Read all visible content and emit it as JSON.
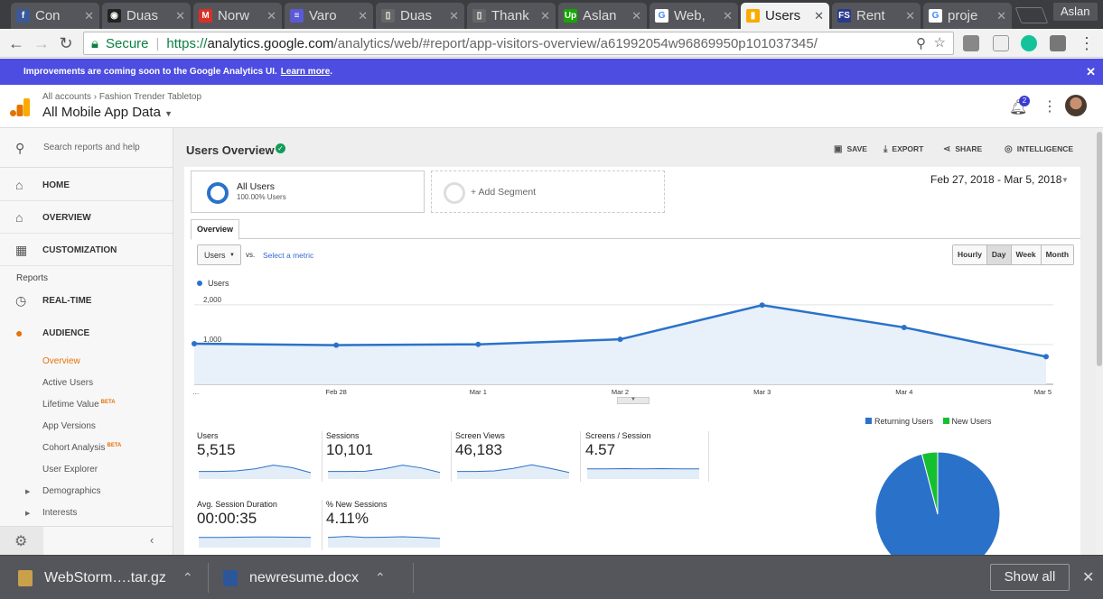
{
  "browser": {
    "tabs": [
      {
        "label": "Con",
        "favicon_color": "#3b5998",
        "favicon_text": "f"
      },
      {
        "label": "Duas",
        "favicon_color": "#222222",
        "favicon_text": "◉"
      },
      {
        "label": "Norw",
        "favicon_color": "#d93025",
        "favicon_text": "M"
      },
      {
        "label": "Varo",
        "favicon_color": "#5a5ad6",
        "favicon_text": "≡"
      },
      {
        "label": "Duas",
        "favicon_color": "#666666",
        "favicon_text": "▯"
      },
      {
        "label": "Thank",
        "favicon_color": "#666666",
        "favicon_text": "▯"
      },
      {
        "label": "Aslan",
        "favicon_color": "#14a800",
        "favicon_text": "Up"
      },
      {
        "label": "Web,",
        "favicon_color": "#ffffff",
        "favicon_text": "G"
      },
      {
        "label": "Users",
        "favicon_color": "#f9ab00",
        "favicon_text": "▮"
      },
      {
        "label": "Rent",
        "favicon_color": "#2a3a8c",
        "favicon_text": "FS"
      },
      {
        "label": "proje",
        "favicon_color": "#ffffff",
        "favicon_text": "G"
      }
    ],
    "active_tab_index": 8,
    "profile_name": "Aslan",
    "secure_label": "Secure",
    "url_scheme": "https://",
    "url_host": "analytics.google.com",
    "url_path": "/analytics/web/#report/app-visitors-overview/a61992054w96869950p101037345/"
  },
  "banner": {
    "text": "Improvements are coming soon to the Google Analytics UI.",
    "link": "Learn more",
    "suffix": "."
  },
  "header": {
    "breadcrumb_root": "All accounts",
    "breadcrumb_sep": "›",
    "breadcrumb_account": "Fashion Trender Tabletop",
    "property": "All Mobile App Data",
    "notification_count": "2"
  },
  "sidebar": {
    "search_placeholder": "Search reports and help",
    "home": "HOME",
    "overview": "OVERVIEW",
    "customization": "CUSTOMIZATION",
    "reports_header": "Reports",
    "realtime": "REAL-TIME",
    "audience": "AUDIENCE",
    "audience_items": [
      {
        "label": "Overview",
        "beta": ""
      },
      {
        "label": "Active Users",
        "beta": ""
      },
      {
        "label": "Lifetime Value",
        "beta": "BETA"
      },
      {
        "label": "App Versions",
        "beta": ""
      },
      {
        "label": "Cohort Analysis",
        "beta": "BETA"
      },
      {
        "label": "User Explorer",
        "beta": ""
      },
      {
        "label": "Demographics",
        "beta": ""
      },
      {
        "label": "Interests",
        "beta": ""
      }
    ]
  },
  "report": {
    "title": "Users Overview",
    "actions": {
      "save": "SAVE",
      "export": "EXPORT",
      "share": "SHARE",
      "intelligence": "INTELLIGENCE"
    },
    "segment_name": "All Users",
    "segment_sub": "100.00% Users",
    "add_segment": "+ Add Segment",
    "date_range": "Feb 27, 2018 - Mar 5, 2018",
    "tab": "Overview",
    "metric": "Users",
    "vs": "vs.",
    "select_metric": "Select a metric",
    "granularity": [
      "Hourly",
      "Day",
      "Week",
      "Month"
    ],
    "granularity_selected": "Day"
  },
  "chart_data": [
    {
      "type": "line",
      "series": [
        {
          "name": "Users",
          "values": [
            1020,
            985,
            1005,
            1130,
            1990,
            1430,
            695
          ]
        }
      ],
      "x": [
        "…",
        "Feb 28",
        "Mar 1",
        "Mar 2",
        "Mar 3",
        "Mar 4",
        "Mar 5"
      ],
      "yticks": [
        "2,000",
        "1,000"
      ],
      "ylim": [
        0,
        2000
      ],
      "color": "#2a72c9"
    },
    {
      "type": "pie",
      "categories": [
        "Returning Users",
        "New Users"
      ],
      "values": [
        95.9,
        4.1
      ],
      "colors": [
        "#2a72c9",
        "#14c030"
      ],
      "labels": [
        "95.9%"
      ]
    }
  ],
  "scorecards": [
    {
      "label": "Users",
      "value": "5,515",
      "spark": [
        3,
        3,
        3.2,
        4,
        5.5,
        4.5,
        2.5
      ]
    },
    {
      "label": "Sessions",
      "value": "10,101",
      "spark": [
        3,
        3,
        3.1,
        4,
        5.5,
        4.4,
        2.6
      ]
    },
    {
      "label": "Screen Views",
      "value": "46,183",
      "spark": [
        3,
        3,
        3.2,
        4.2,
        5.6,
        4.2,
        2.6
      ]
    },
    {
      "label": "Screens / Session",
      "value": "4.57",
      "spark": [
        4,
        4,
        4.1,
        4,
        4.1,
        4,
        4
      ]
    },
    {
      "label": "Avg. Session Duration",
      "value": "00:00:35",
      "spark": [
        4,
        4,
        4.1,
        4.2,
        4.2,
        4.1,
        4
      ]
    },
    {
      "label": "% New Sessions",
      "value": "4.11%",
      "spark": [
        4,
        4.4,
        4,
        4.1,
        4.3,
        4,
        3.6
      ]
    }
  ],
  "downloads": [
    {
      "name": "WebStorm….tar.gz",
      "icon_color": "#c9a14a"
    },
    {
      "name": "newresume.docx",
      "icon_color": "#2b579a"
    }
  ],
  "shelf": {
    "show_all": "Show all"
  }
}
